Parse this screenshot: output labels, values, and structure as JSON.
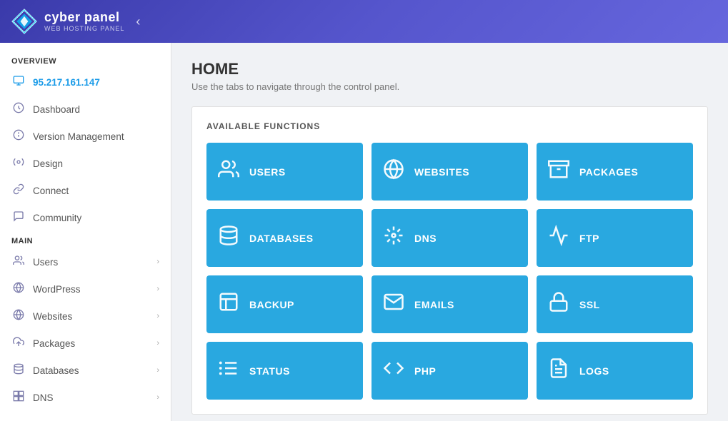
{
  "header": {
    "logo_name": "cyber panel",
    "logo_sub": "WEB HOSTING PANEL",
    "toggle_icon": "☰"
  },
  "sidebar": {
    "overview_label": "OVERVIEW",
    "main_label": "MAIN",
    "ip": "95.217.161.147",
    "overview_items": [
      {
        "id": "ip-address",
        "label": "95.217.161.147",
        "icon": "🖥",
        "active": true
      },
      {
        "id": "dashboard",
        "label": "Dashboard",
        "icon": "🎨"
      },
      {
        "id": "version-management",
        "label": "Version Management",
        "icon": "ℹ"
      },
      {
        "id": "design",
        "label": "Design",
        "icon": "⚙"
      },
      {
        "id": "connect",
        "label": "Connect",
        "icon": "🔗"
      },
      {
        "id": "community",
        "label": "Community",
        "icon": "💬"
      }
    ],
    "main_items": [
      {
        "id": "users",
        "label": "Users",
        "icon": "👥",
        "has_arrow": true
      },
      {
        "id": "wordpress",
        "label": "WordPress",
        "icon": "Ⓦ",
        "has_arrow": true
      },
      {
        "id": "websites",
        "label": "Websites",
        "icon": "🌐",
        "has_arrow": true
      },
      {
        "id": "packages",
        "label": "Packages",
        "icon": "📦",
        "has_arrow": true
      },
      {
        "id": "databases",
        "label": "Databases",
        "icon": "🗄",
        "has_arrow": true
      },
      {
        "id": "dns",
        "label": "DNS",
        "icon": "📡",
        "has_arrow": true
      }
    ]
  },
  "main": {
    "title": "HOME",
    "subtitle": "Use the tabs to navigate through the control panel.",
    "functions_title": "AVAILABLE FUNCTIONS",
    "tiles": [
      {
        "id": "users",
        "label": "USERS",
        "icon": "👥"
      },
      {
        "id": "websites",
        "label": "WEBSITES",
        "icon": "🌐"
      },
      {
        "id": "packages",
        "label": "PACKAGES",
        "icon": "📦"
      },
      {
        "id": "databases",
        "label": "DATABASES",
        "icon": "🗄"
      },
      {
        "id": "dns",
        "label": "DNS",
        "icon": "📊"
      },
      {
        "id": "ftp",
        "label": "FTP",
        "icon": "☁"
      },
      {
        "id": "backup",
        "label": "BACKUP",
        "icon": "📋"
      },
      {
        "id": "emails",
        "label": "EMAILS",
        "icon": "✉"
      },
      {
        "id": "ssl",
        "label": "SSL",
        "icon": "🔒"
      },
      {
        "id": "status",
        "label": "STATUS",
        "icon": "📃"
      },
      {
        "id": "php",
        "label": "PHP",
        "icon": "⟨/⟩"
      },
      {
        "id": "logs",
        "label": "LOGS",
        "icon": "📄"
      }
    ]
  }
}
